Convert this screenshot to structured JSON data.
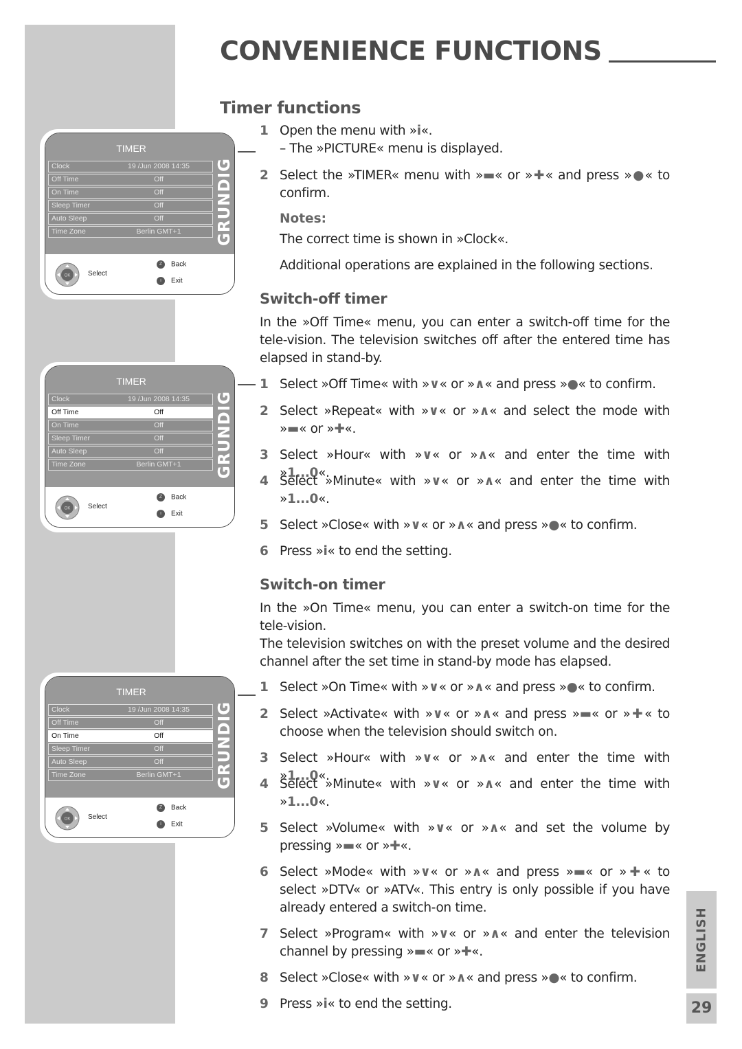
{
  "header": {
    "section_title": "CONVENIENCE FUNCTIONS",
    "page_heading": "Timer functions"
  },
  "intro": {
    "step1_num": "1",
    "step1_text": "Open the menu with »i«.",
    "step1_sub": "– The »PICTURE« menu is displayed.",
    "step2_num": "2",
    "step2_text": "Select the »TIMER« menu with »▬« or »✚« and press »●« to confirm.",
    "notes_label": "Notes:",
    "note1": "The correct time is shown in »Clock«.",
    "note2": "Additional operations are explained in the following sections."
  },
  "switch_off": {
    "heading": "Switch-off timer",
    "description": "In the »Off Time« menu, you can enter a switch-off time for the tele-vision. The television switches off after the entered time has elapsed in stand-by.",
    "steps": [
      {
        "num": "1",
        "text": "Select »Off Time« with »∨« or »∧« and press »●« to confirm."
      },
      {
        "num": "2",
        "text": "Select »Repeat« with »∨« or »∧« and select the mode with »▬« or »✚«."
      },
      {
        "num": "3",
        "text": "Select »Hour« with »∨« or »∧« and enter the time with »1...0«."
      },
      {
        "num": "4",
        "text": "Select »Minute« with »∨« or »∧« and enter the time with »1...0«."
      },
      {
        "num": "5",
        "text": "Select »Close« with »∨« or »∧« and press »●« to confirm."
      },
      {
        "num": "6",
        "text": "Press »i« to end the setting."
      }
    ]
  },
  "switch_on": {
    "heading": "Switch-on timer",
    "description1": "In the »On Time« menu, you can enter a switch-on time for the tele-vision.",
    "description2": "The television switches on with the preset volume and the desired channel after the set time in stand-by mode has elapsed.",
    "steps": [
      {
        "num": "1",
        "text": "Select »On Time« with »∨« or »∧« and press »●« to confirm."
      },
      {
        "num": "2",
        "text": "Select »Activate« with »∨« or »∧« and press »▬« or »✚« to choose when the television should switch on."
      },
      {
        "num": "3",
        "text": "Select »Hour« with »∨« or »∧« and enter the time with »1...0«."
      },
      {
        "num": "4",
        "text": "Select »Minute« with »∨« or »∧« and enter the time with »1...0«."
      },
      {
        "num": "5",
        "text": "Select »Volume« with »∨« or »∧« and set the volume by pressing »▬« or »✚«."
      },
      {
        "num": "6",
        "text": "Select »Mode« with »∨« or »∧« and press »▬« or »✚« to select »DTV« or »ATV«. This entry is only possible if you have already entered a switch-on time."
      },
      {
        "num": "7",
        "text": "Select »Program« with »∨« or »∧« and enter the television channel by pressing »▬« or »✚«."
      },
      {
        "num": "8",
        "text": "Select »Close« with »∨« or »∧« and press »●« to confirm."
      },
      {
        "num": "9",
        "text": "Press »i« to end the setting."
      }
    ]
  },
  "tv_menu": {
    "title": "TIMER",
    "brand": "GRUNDIG",
    "rows": [
      {
        "label": "Clock",
        "value": "19 /Jun 2008 14:35"
      },
      {
        "label": "Off Time",
        "value": "Off"
      },
      {
        "label": "On Time",
        "value": "Off"
      },
      {
        "label": "Sleep Timer",
        "value": "Off"
      },
      {
        "label": "Auto Sleep",
        "value": "Off"
      },
      {
        "label": "Time Zone",
        "value": "Berlin GMT+1"
      }
    ],
    "ok_label": "OK",
    "select_label": "Select",
    "back_key": "Z",
    "back_label": "Back",
    "exit_key": "i",
    "exit_label": "Exit",
    "screens": [
      {
        "selected_row": null
      },
      {
        "selected_row": "Off Time"
      },
      {
        "selected_row": "On Time"
      }
    ]
  },
  "footer": {
    "language": "ENGLISH",
    "page_number": "29"
  },
  "colors": {
    "sidebar": "#cbcbcb",
    "heading": "#4a4a4a",
    "menu_bg": "#999999"
  }
}
